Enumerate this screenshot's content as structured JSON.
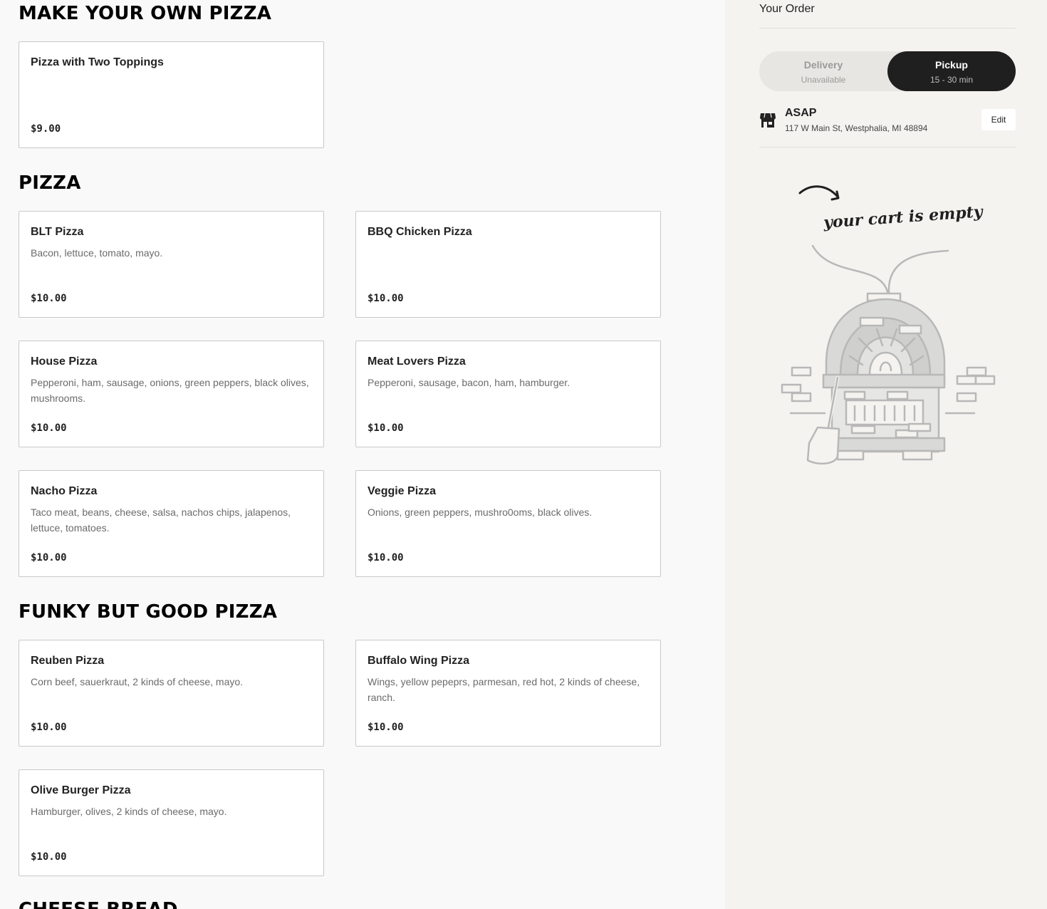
{
  "menu": {
    "sections": [
      {
        "title": "MAKE YOUR OWN PIZZA",
        "items": [
          {
            "name": "Pizza with Two Toppings",
            "description": "",
            "price": "$9.00"
          }
        ]
      },
      {
        "title": "PIZZA",
        "items": [
          {
            "name": "BLT Pizza",
            "description": "Bacon, lettuce, tomato, mayo.",
            "price": "$10.00"
          },
          {
            "name": "BBQ Chicken Pizza",
            "description": "",
            "price": "$10.00"
          },
          {
            "name": "House Pizza",
            "description": "Pepperoni, ham, sausage, onions, green peppers, black olives, mushrooms.",
            "price": "$10.00"
          },
          {
            "name": "Meat Lovers Pizza",
            "description": "Pepperoni, sausage, bacon, ham, hamburger.",
            "price": "$10.00"
          },
          {
            "name": "Nacho Pizza",
            "description": "Taco meat, beans, cheese, salsa, nachos chips, jalapenos, lettuce, tomatoes.",
            "price": "$10.00"
          },
          {
            "name": "Veggie Pizza",
            "description": "Onions, green peppers, mushro0oms, black olives.",
            "price": "$10.00"
          }
        ]
      },
      {
        "title": "FUNKY BUT GOOD PIZZA",
        "items": [
          {
            "name": "Reuben Pizza",
            "description": "Corn beef, sauerkraut, 2 kinds of cheese, mayo.",
            "price": "$10.00"
          },
          {
            "name": "Buffalo Wing Pizza",
            "description": "Wings, yellow pepeprs, parmesan, red hot, 2 kinds of cheese, ranch.",
            "price": "$10.00"
          },
          {
            "name": "Olive Burger Pizza",
            "description": "Hamburger, olives, 2 kinds of cheese, mayo.",
            "price": "$10.00"
          }
        ]
      },
      {
        "title": "CHEESE BREAD",
        "items": []
      }
    ]
  },
  "order": {
    "title": "Your Order",
    "delivery": {
      "label": "Delivery",
      "sub": "Unavailable"
    },
    "pickup": {
      "label": "Pickup",
      "sub": "15 - 30 min"
    },
    "time": "ASAP",
    "address": "117 W Main St, Westphalia, MI 48894",
    "edit_label": "Edit",
    "empty_message": "your cart is empty"
  },
  "icons": {
    "store": "store-icon",
    "arrow": "curved-arrow-icon",
    "oven": "pizza-oven-illustration"
  },
  "colors": {
    "accent": "#1f1f1f",
    "sidebar_bg": "#f4f3f0"
  }
}
